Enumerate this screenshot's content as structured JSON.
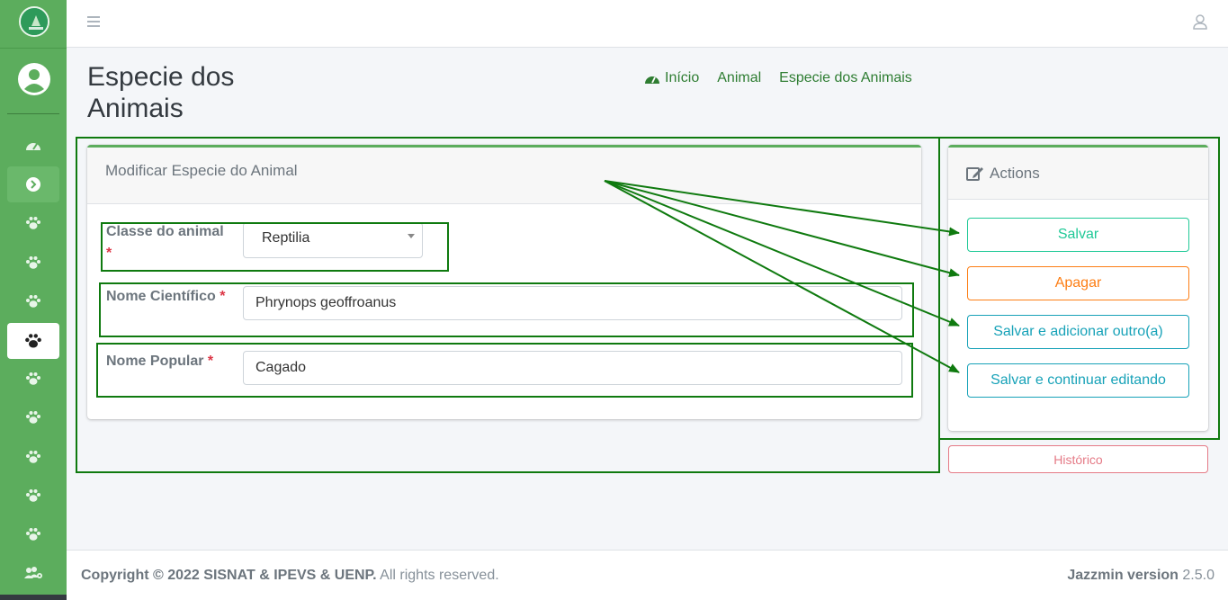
{
  "page": {
    "title": "Especie dos Animais"
  },
  "breadcrumb": {
    "home": "Início",
    "animal": "Animal",
    "current": "Especie dos Animais"
  },
  "form": {
    "header": "Modificar Especie do Animal",
    "classe_label": "Classe do animal",
    "classe_value": "Reptilia",
    "nome_cientifico_label": "Nome Científico",
    "nome_cientifico_value": "Phrynops geoffroanus",
    "nome_popular_label": "Nome Popular",
    "nome_popular_value": "Cagado",
    "required_mark": "*"
  },
  "actions": {
    "title": "Actions",
    "save": "Salvar",
    "delete": "Apagar",
    "save_add": "Salvar e adicionar outro(a)",
    "save_continue": "Salvar e continuar editando",
    "history": "Histórico"
  },
  "footer": {
    "copyright_bold": "Copyright © 2022 SISNAT & IPEVS & UENP.",
    "copyright_rest": "All rights reserved.",
    "version_label": "Jazzmin version",
    "version_value": "2.5.0"
  },
  "colors": {
    "sidebar": "#5cad5d",
    "accent": "#2e7d32",
    "annotation": "#0f7a0f"
  },
  "icons": {
    "menu": "hamburger-icon",
    "user": "user-icon",
    "nav": "paw-icon",
    "home": "tachometer-icon"
  }
}
